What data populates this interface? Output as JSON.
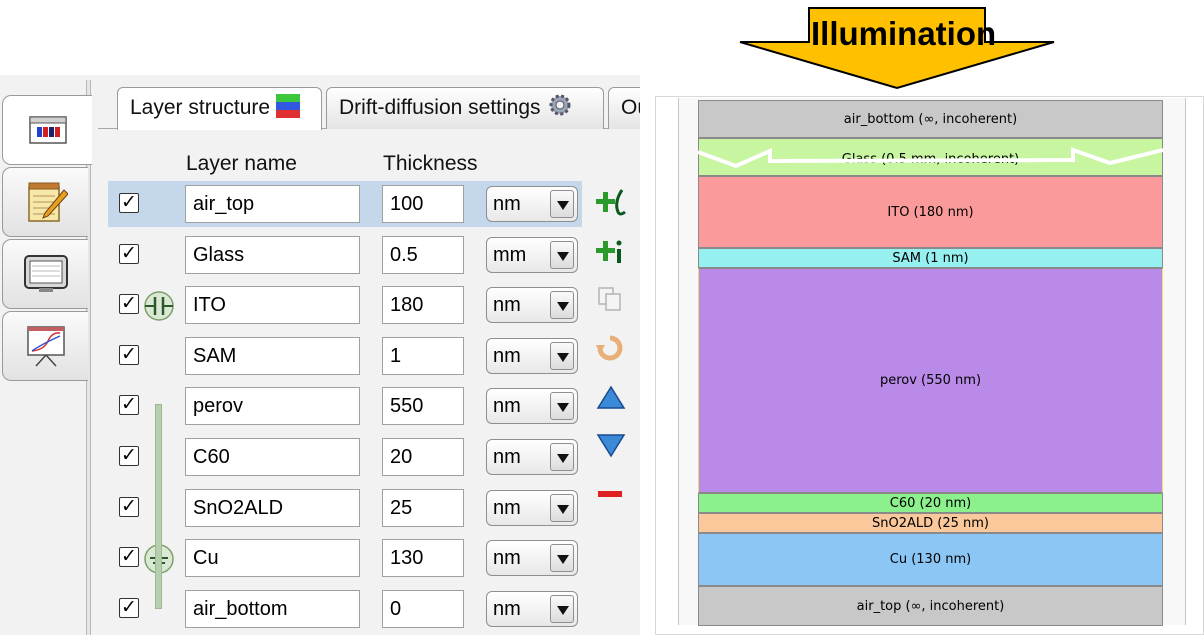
{
  "editor": {
    "tabs": [
      {
        "label": "Layer structure",
        "active": true
      },
      {
        "label": "Drift-diffusion settings",
        "active": false
      },
      {
        "label": "Ou",
        "active": false
      }
    ],
    "headers": {
      "name": "Layer name",
      "thickness": "Thickness"
    },
    "layers": [
      {
        "name": "air_top",
        "thickness": "100",
        "unit": "nm",
        "checked": "✓",
        "selected": true
      },
      {
        "name": "Glass",
        "thickness": "0.5",
        "unit": "mm",
        "checked": "✓"
      },
      {
        "name": "ITO",
        "thickness": "180",
        "unit": "nm",
        "checked": "✓",
        "marker": "capacitor-icon"
      },
      {
        "name": "SAM",
        "thickness": "1",
        "unit": "nm",
        "checked": "✓"
      },
      {
        "name": "perov",
        "thickness": "550",
        "unit": "nm",
        "checked": "✓"
      },
      {
        "name": "C60",
        "thickness": "20",
        "unit": "nm",
        "checked": "✓"
      },
      {
        "name": "SnO2ALD",
        "thickness": "25",
        "unit": "nm",
        "checked": "✓"
      },
      {
        "name": "Cu",
        "thickness": "130",
        "unit": "nm",
        "checked": "✓",
        "marker": "ground-icon"
      },
      {
        "name": "air_bottom",
        "thickness": "0",
        "unit": "nm",
        "checked": "✓"
      }
    ],
    "side_tab_icons": [
      "layer-stack-icon",
      "notepad-icon",
      "monitor-icon",
      "plot-icon"
    ],
    "toolbar_icons": [
      "add-layer-icon",
      "insert-layer-icon",
      "copy-layer-icon",
      "reverse-layers-icon",
      "move-up-icon",
      "move-down-icon",
      "delete-layer-icon"
    ]
  },
  "illumination": {
    "label": "Illumination",
    "color": "#ffc000"
  },
  "stack": [
    {
      "label": "air_bottom (∞, incoherent)",
      "color": "#c8c8c8"
    },
    {
      "label": "Glass (0.5 mm, incoherent)",
      "color": "#c8f5a0"
    },
    {
      "label": "ITO (180 nm)",
      "color": "#fa9a9a"
    },
    {
      "label": "SAM (1 nm)",
      "color": "#96f0f0"
    },
    {
      "label": "perov (550 nm)",
      "color": "#b98ae8"
    },
    {
      "label": "C60 (20 nm)",
      "color": "#8cf08c"
    },
    {
      "label": "SnO2ALD (25 nm)",
      "color": "#fac89a"
    },
    {
      "label": "Cu (130 nm)",
      "color": "#8cc6f5"
    },
    {
      "label": "air_top (∞, incoherent)",
      "color": "#c8c8c8"
    }
  ]
}
